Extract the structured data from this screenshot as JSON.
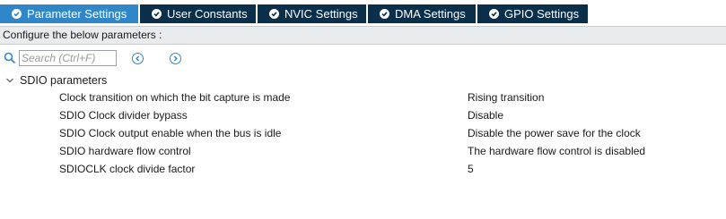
{
  "tabs": [
    {
      "label": "Parameter Settings",
      "active": true
    },
    {
      "label": "User Constants",
      "active": false
    },
    {
      "label": "NVIC Settings",
      "active": false
    },
    {
      "label": "DMA Settings",
      "active": false
    },
    {
      "label": "GPIO Settings",
      "active": false
    }
  ],
  "banner": "Configure the below parameters :",
  "search": {
    "placeholder": "Search (Ctrl+F)",
    "icon": "search-icon"
  },
  "group": {
    "label": "SDIO parameters",
    "expanded": true
  },
  "params": [
    {
      "name": "Clock transition on which the bit capture is made",
      "value": "Rising transition"
    },
    {
      "name": "SDIO Clock divider bypass",
      "value": "Disable"
    },
    {
      "name": "SDIO Clock output enable when the bus is idle",
      "value": "Disable the power save for the clock"
    },
    {
      "name": "SDIO hardware flow control",
      "value": "The hardware flow control is disabled"
    },
    {
      "name": "SDIOCLK clock divide factor",
      "value": "5"
    }
  ],
  "colors": {
    "tab_active": "#2f87c9",
    "tab_inactive": "#0a2f4a",
    "banner_bg": "#e9ecef",
    "accent": "#2f87c9"
  }
}
